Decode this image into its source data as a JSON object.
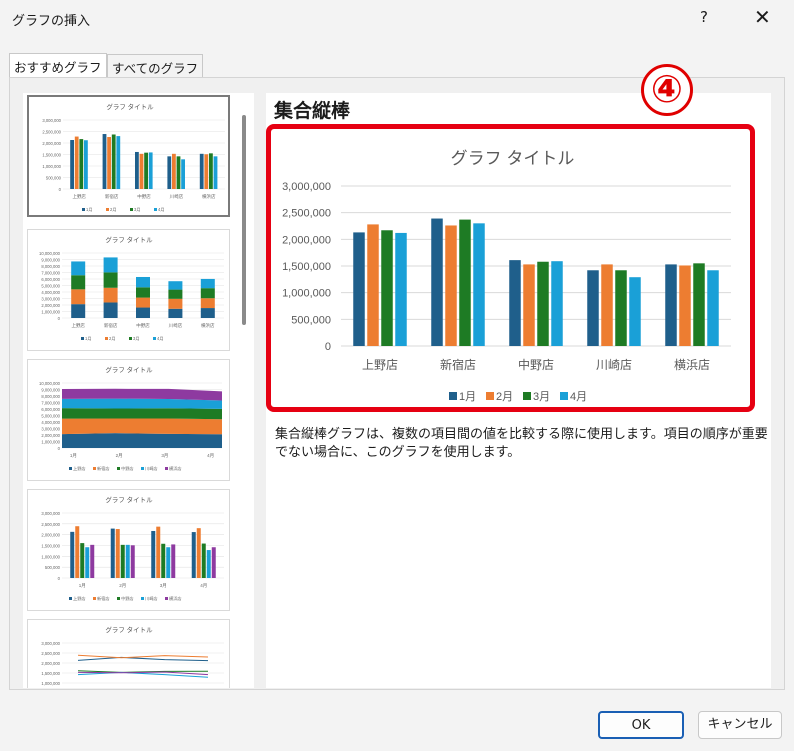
{
  "window": {
    "title": "グラフの挿入",
    "help": "?",
    "close": "✕"
  },
  "tabs": [
    {
      "label": "おすすめグラフ"
    },
    {
      "label": "すべてのグラフ"
    }
  ],
  "heading": "集合縦棒",
  "annotation_badge": "④",
  "description": "集合縦棒グラフは、複数の項目間の値を比較する際に使用します。項目の順序が重要でない場合に、このグラフを使用します。",
  "buttons": {
    "ok": "OK",
    "cancel": "キャンセル"
  },
  "colors": {
    "series": [
      "#1f5f8b",
      "#ed7d31",
      "#1e7b24",
      "#1aa0d7"
    ],
    "highlight": "#e60012"
  },
  "thumbnails": [
    {
      "title": "グラフ タイトル",
      "yticks": [
        "3,000,000",
        "2,500,000",
        "2,000,000",
        "1,500,000",
        "1,000,000",
        "500,000",
        "0"
      ],
      "categories": [
        "上野店",
        "新宿店",
        "中野店",
        "川崎店",
        "横浜店"
      ],
      "legend": [
        "1月",
        "2月",
        "3月",
        "4月"
      ]
    },
    {
      "title": "グラフ タイトル",
      "yticks": [
        "10,000,000",
        "9,000,000",
        "8,000,000",
        "7,000,000",
        "6,000,000",
        "5,000,000",
        "4,000,000",
        "3,000,000",
        "2,000,000",
        "1,000,000",
        "0"
      ],
      "categories": [
        "上野店",
        "新宿店",
        "中野店",
        "川崎店",
        "横浜店"
      ],
      "legend": [
        "1月",
        "2月",
        "3月",
        "4月"
      ]
    },
    {
      "title": "グラフ タイトル",
      "yticks": [
        "10,000,000",
        "9,000,000",
        "8,000,000",
        "7,000,000",
        "6,000,000",
        "5,000,000",
        "4,000,000",
        "3,000,000",
        "2,000,000",
        "1,000,000",
        "0"
      ],
      "categories": [
        "1月",
        "",
        "2月",
        "",
        "3月",
        "",
        "4月"
      ],
      "legend": [
        "上野店",
        "新宿店",
        "中野店",
        "川崎店",
        "横浜店"
      ]
    },
    {
      "title": "グラフ タイトル",
      "yticks": [
        "3,000,000",
        "2,500,000",
        "2,000,000",
        "1,500,000",
        "1,000,000",
        "500,000",
        "0"
      ],
      "categories": [
        "1月",
        "2月",
        "3月",
        "4月"
      ],
      "legend": [
        "上野店",
        "新宿店",
        "中野店",
        "川崎店",
        "横浜店"
      ]
    },
    {
      "title": "グラフ タイトル",
      "yticks": [
        "3,000,000",
        "2,500,000",
        "2,000,000",
        "1,500,000",
        "1,000,000",
        "500,000"
      ],
      "categories": [],
      "legend": []
    }
  ],
  "chart_data": {
    "type": "bar",
    "title": "グラフ タイトル",
    "categories": [
      "上野店",
      "新宿店",
      "中野店",
      "川崎店",
      "横浜店"
    ],
    "yticks": [
      "3,000,000",
      "2,500,000",
      "2,000,000",
      "1,500,000",
      "1,000,000",
      "500,000",
      "0"
    ],
    "ylim": [
      0,
      3000000
    ],
    "grid": true,
    "legend_position": "bottom",
    "series": [
      {
        "name": "1月",
        "values": [
          2130000,
          2390000,
          1610000,
          1420000,
          1530000
        ]
      },
      {
        "name": "2月",
        "values": [
          2280000,
          2260000,
          1530000,
          1530000,
          1510000
        ]
      },
      {
        "name": "3月",
        "values": [
          2170000,
          2370000,
          1580000,
          1420000,
          1550000
        ]
      },
      {
        "name": "4月",
        "values": [
          2120000,
          2300000,
          1590000,
          1290000,
          1420000
        ]
      }
    ]
  }
}
